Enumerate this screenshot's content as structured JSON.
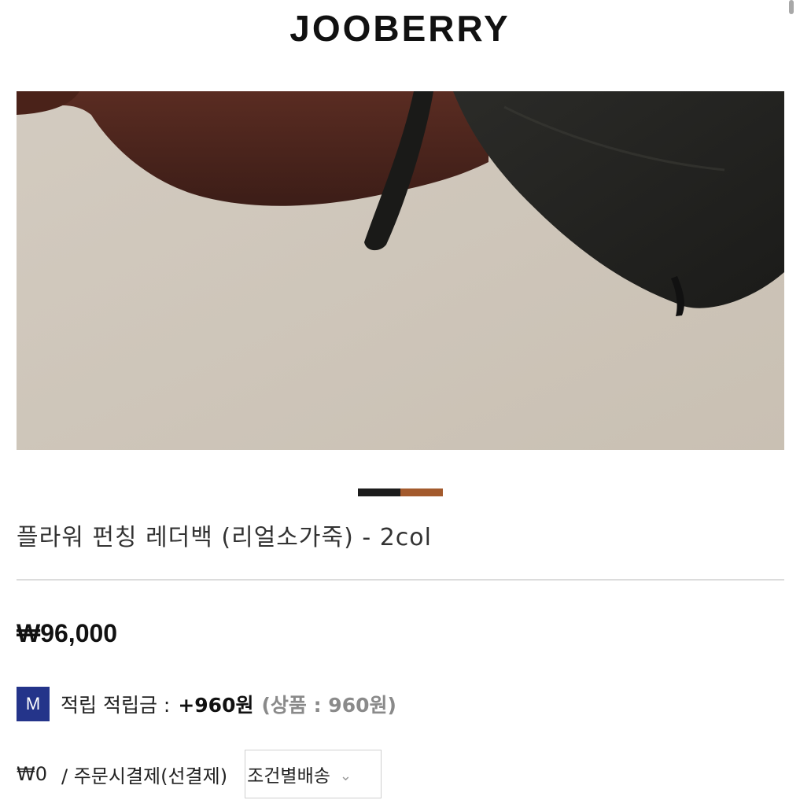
{
  "brand": "JOOBERRY",
  "product": {
    "title": "플라워 펀칭 레더백 (리얼소가죽) - 2col",
    "price": "₩96,000",
    "color_swatches": [
      "#1c1c1c",
      "#a35a2d"
    ]
  },
  "points": {
    "badge": "M",
    "label": "적립 적립금 :",
    "amount": "+960원",
    "detail": "(상품 : 960원)"
  },
  "shipping": {
    "fee": "₩0",
    "method": "/ 주문시결제(선결제)",
    "select_value": "조건별배송"
  },
  "icons": {
    "select_arrow": "chevron-down-icon"
  }
}
